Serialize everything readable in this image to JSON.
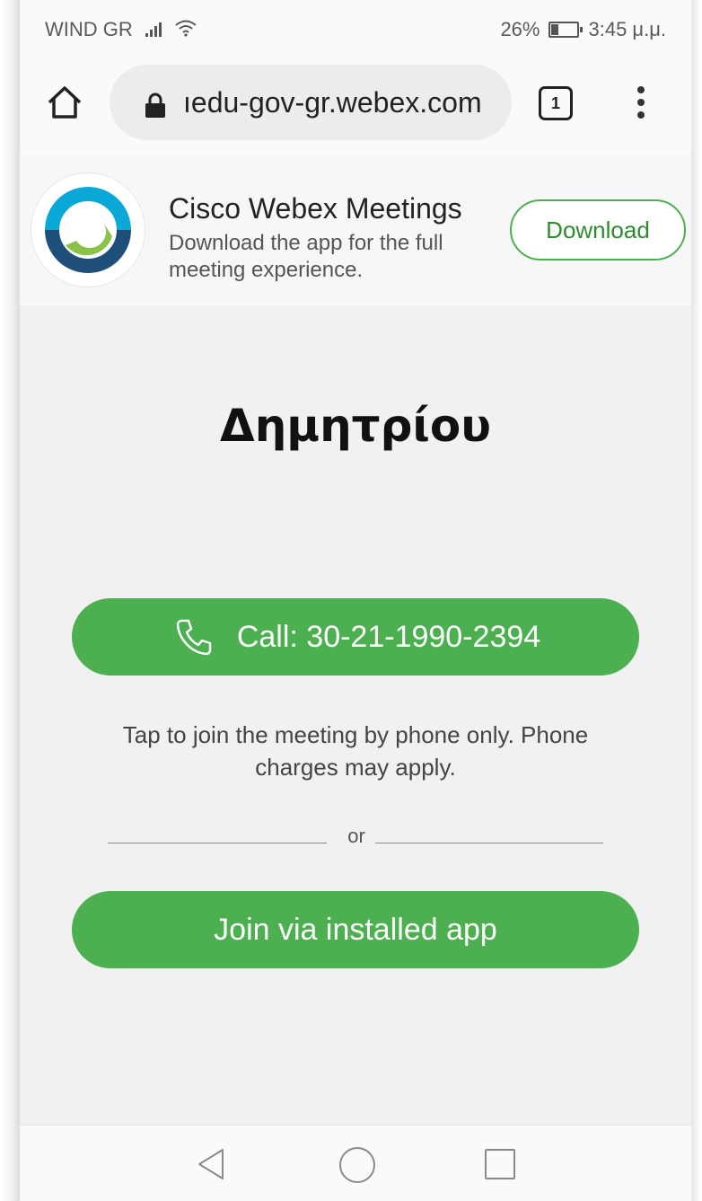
{
  "status_bar": {
    "carrier": "WIND GR",
    "battery": "26%",
    "time": "3:45 μ.μ."
  },
  "browser": {
    "url": "ıedu-gov-gr.webex.com",
    "tab_count": "1"
  },
  "app_banner": {
    "name": "Cisco Webex Meetings",
    "description": "Download the app for the full meeting experience.",
    "download_label": "Download"
  },
  "meeting": {
    "host_name": "Δημητρίου",
    "call_label": "Call: 30-21-1990-2394",
    "phone_hint": "Tap to join the meeting by phone only. Phone charges may apply.",
    "or_label": "or",
    "join_label": "Join via installed app"
  },
  "colors": {
    "accent_green": "#4caf50",
    "webex_blue": "#0aa8d6",
    "webex_dark": "#1d4f7a",
    "webex_green": "#8bc34a"
  },
  "icons": [
    "home-icon",
    "lock-icon",
    "tabs-icon",
    "overflow-menu-icon",
    "webex-logo",
    "phone-icon",
    "back-icon",
    "home-circle-icon",
    "recents-icon"
  ]
}
